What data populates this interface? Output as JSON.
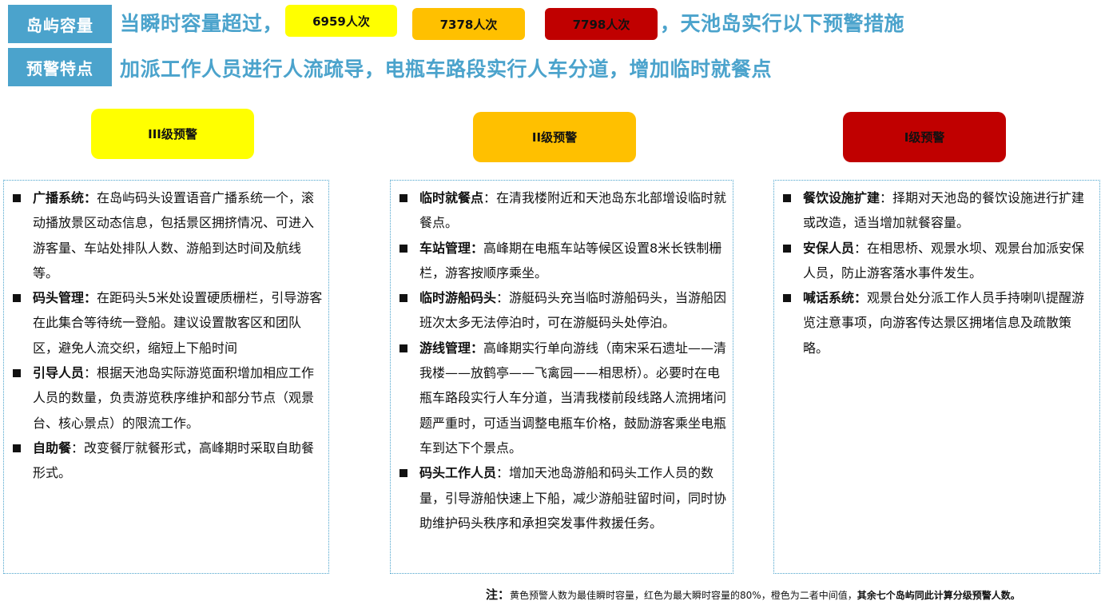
{
  "header": {
    "row1_label": "岛屿容量",
    "row1_text_before": "当瞬时容量超过，",
    "row1_text_after": "，天池岛实行以下预警措施",
    "row2_label": "预警特点",
    "row2_text": "加派工作人员进行人流疏导，电瓶车路段实行人车分道，增加临时就餐点"
  },
  "thresholds": [
    {
      "label": "6959人次",
      "color": "#FFFF00"
    },
    {
      "label": "7378人次",
      "color": "#FFC000"
    },
    {
      "label": "7798人次",
      "color": "#C00000"
    }
  ],
  "levels": [
    {
      "label": "III级预警",
      "color": "#FFFF00"
    },
    {
      "label": "II级预警",
      "color": "#FFC000"
    },
    {
      "label": "I级预警",
      "color": "#C00000"
    }
  ],
  "columns": [
    {
      "items": [
        {
          "title": "广播系统：",
          "text": "在岛屿码头设置语音广播系统一个，滚动播放景区动态信息，包括景区拥挤情况、可进入游客量、车站处排队人数、游船到达时间及航线等。"
        },
        {
          "title": "码头管理：",
          "text": "在距码头5米处设置硬质栅栏，引导游客在此集合等待统一登船。建议设置散客区和团队区，避免人流交织，缩短上下船时间"
        },
        {
          "title": "引导人员",
          "text": "：根据天池岛实际游览面积增加相应工作人员的数量，负责游览秩序维护和部分节点（观景台、核心景点）的限流工作。"
        },
        {
          "title": "自助餐",
          "text": "：改变餐厅就餐形式，高峰期时采取自助餐形式。"
        }
      ]
    },
    {
      "items": [
        {
          "title": "临时就餐点",
          "text": "：在清我楼附近和天池岛东北部增设临时就餐点。"
        },
        {
          "title": "车站管理：",
          "text": "高峰期在电瓶车站等候区设置8米长铁制栅栏，游客按顺序乘坐。"
        },
        {
          "title": "临时游船码头",
          "text": "：游艇码头充当临时游船码头，当游船因班次太多无法停泊时，可在游艇码头处停泊。"
        },
        {
          "title": "游线管理：",
          "text": "高峰期实行单向游线（南宋采石遗址——清我楼——放鹤亭——飞禽园——相思桥）。必要时在电瓶车路段实行人车分道，当清我楼前段线路人流拥堵问题严重时，可适当调整电瓶车价格，鼓励游客乘坐电瓶车到达下个景点。"
        },
        {
          "title": "码头工作人员",
          "text": "：增加天池岛游船和码头工作人员的数量，引导游船快速上下船，减少游船驻留时间，同时协助维护码头秩序和承担突发事件救援任务。"
        }
      ]
    },
    {
      "items": [
        {
          "title": "餐饮设施扩建",
          "text": "：择期对天池岛的餐饮设施进行扩建或改造，适当增加就餐容量。"
        },
        {
          "title": "安保人员",
          "text": "：在相思桥、观景水坝、观景台加派安保人员，防止游客落水事件发生。"
        },
        {
          "title": "喊话系统：",
          "text": "观景台处分派工作人员手持喇叭提醒游览注意事项，向游客传达景区拥堵信息及疏散策略。"
        }
      ]
    }
  ],
  "note": {
    "prefix": "注：",
    "text": "黄色预警人数为最佳瞬时容量，红色为最大瞬时容量的80%，橙色为二者中间值，",
    "bold_tail": "其余七个岛屿同此计算分级预警人数。"
  }
}
